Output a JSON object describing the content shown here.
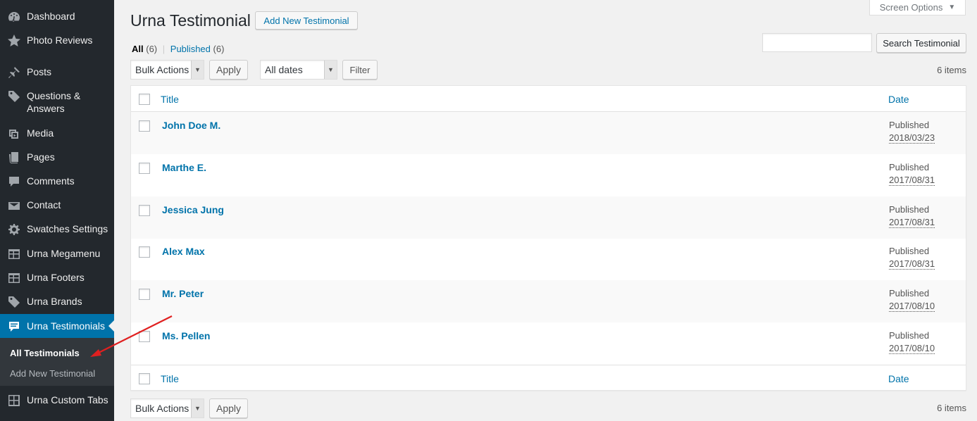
{
  "sidebar": {
    "items": [
      {
        "label": "Dashboard",
        "icon": "dashboard-icon"
      },
      {
        "label": "Photo Reviews",
        "icon": "star-icon"
      },
      {
        "label": "Posts",
        "icon": "pin-icon"
      },
      {
        "label": "Questions & Answers",
        "icon": "tag-icon"
      },
      {
        "label": "Media",
        "icon": "media-icon"
      },
      {
        "label": "Pages",
        "icon": "pages-icon"
      },
      {
        "label": "Comments",
        "icon": "comment-icon"
      },
      {
        "label": "Contact",
        "icon": "mail-icon"
      },
      {
        "label": "Swatches Settings",
        "icon": "gear-icon"
      },
      {
        "label": "Urna Megamenu",
        "icon": "table-icon"
      },
      {
        "label": "Urna Footers",
        "icon": "table-icon"
      },
      {
        "label": "Urna Brands",
        "icon": "tag-icon"
      },
      {
        "label": "Urna Testimonials",
        "icon": "testimonial-icon"
      },
      {
        "label": "Urna Custom Tabs",
        "icon": "grid-icon"
      }
    ],
    "submenu": [
      {
        "label": "All Testimonials"
      },
      {
        "label": "Add New Testimonial"
      }
    ]
  },
  "header": {
    "title": "Urna Testimonial",
    "add_new_label": "Add New Testimonial",
    "screen_options_label": "Screen Options"
  },
  "filters": {
    "all_label": "All",
    "all_count": "(6)",
    "separator": "|",
    "published_label": "Published",
    "published_count": "(6)"
  },
  "search": {
    "placeholder": "",
    "button_label": "Search Testimonial"
  },
  "actions": {
    "bulk_label": "Bulk Actions",
    "apply_label": "Apply",
    "dates_label": "All dates",
    "filter_label": "Filter",
    "items_count": "6 items"
  },
  "table": {
    "columns": {
      "title": "Title",
      "date": "Date"
    },
    "rows": [
      {
        "title": "John Doe M.",
        "status": "Published",
        "date": "2018/03/23"
      },
      {
        "title": "Marthe E.",
        "status": "Published",
        "date": "2017/08/31"
      },
      {
        "title": "Jessica Jung",
        "status": "Published",
        "date": "2017/08/31"
      },
      {
        "title": "Alex Max",
        "status": "Published",
        "date": "2017/08/31"
      },
      {
        "title": "Mr. Peter",
        "status": "Published",
        "date": "2017/08/10"
      },
      {
        "title": "Ms. Pellen",
        "status": "Published",
        "date": "2017/08/10"
      }
    ]
  },
  "colors": {
    "sidebar_bg": "#23282d",
    "active_bg": "#0073aa",
    "link": "#0073aa",
    "annotation_arrow": "#e02020"
  }
}
